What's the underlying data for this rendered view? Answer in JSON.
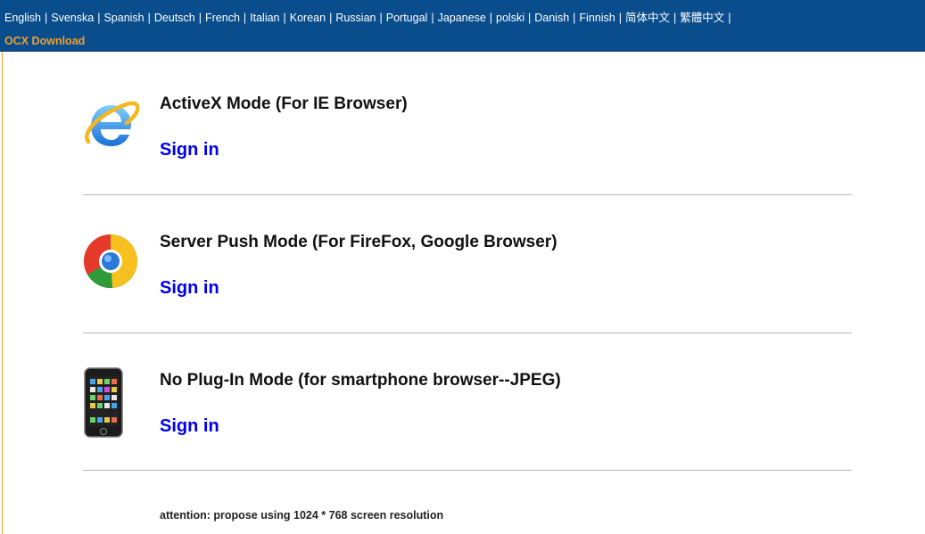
{
  "header": {
    "languages": [
      "English",
      "Svenska",
      "Spanish",
      "Deutsch",
      "French",
      "Italian",
      "Korean",
      "Russian",
      "Portugal",
      "Japanese",
      "polski",
      "Danish",
      "Finnish",
      "简体中文",
      "繁體中文"
    ],
    "ocx_download": "OCX Download"
  },
  "modes": [
    {
      "title": "ActiveX Mode (For IE Browser)",
      "signin": "Sign in",
      "icon": "ie-icon"
    },
    {
      "title": "Server Push Mode (For FireFox, Google Browser)",
      "signin": "Sign in",
      "icon": "chrome-icon"
    },
    {
      "title": "No Plug-In Mode (for smartphone browser--JPEG)",
      "signin": "Sign in",
      "icon": "smartphone-icon"
    }
  ],
  "attention": "attention: propose using 1024 * 768 screen resolution",
  "colors": {
    "header_bg": "#0a4d8c",
    "ocx": "#f0a030",
    "link": "#0000ee"
  }
}
